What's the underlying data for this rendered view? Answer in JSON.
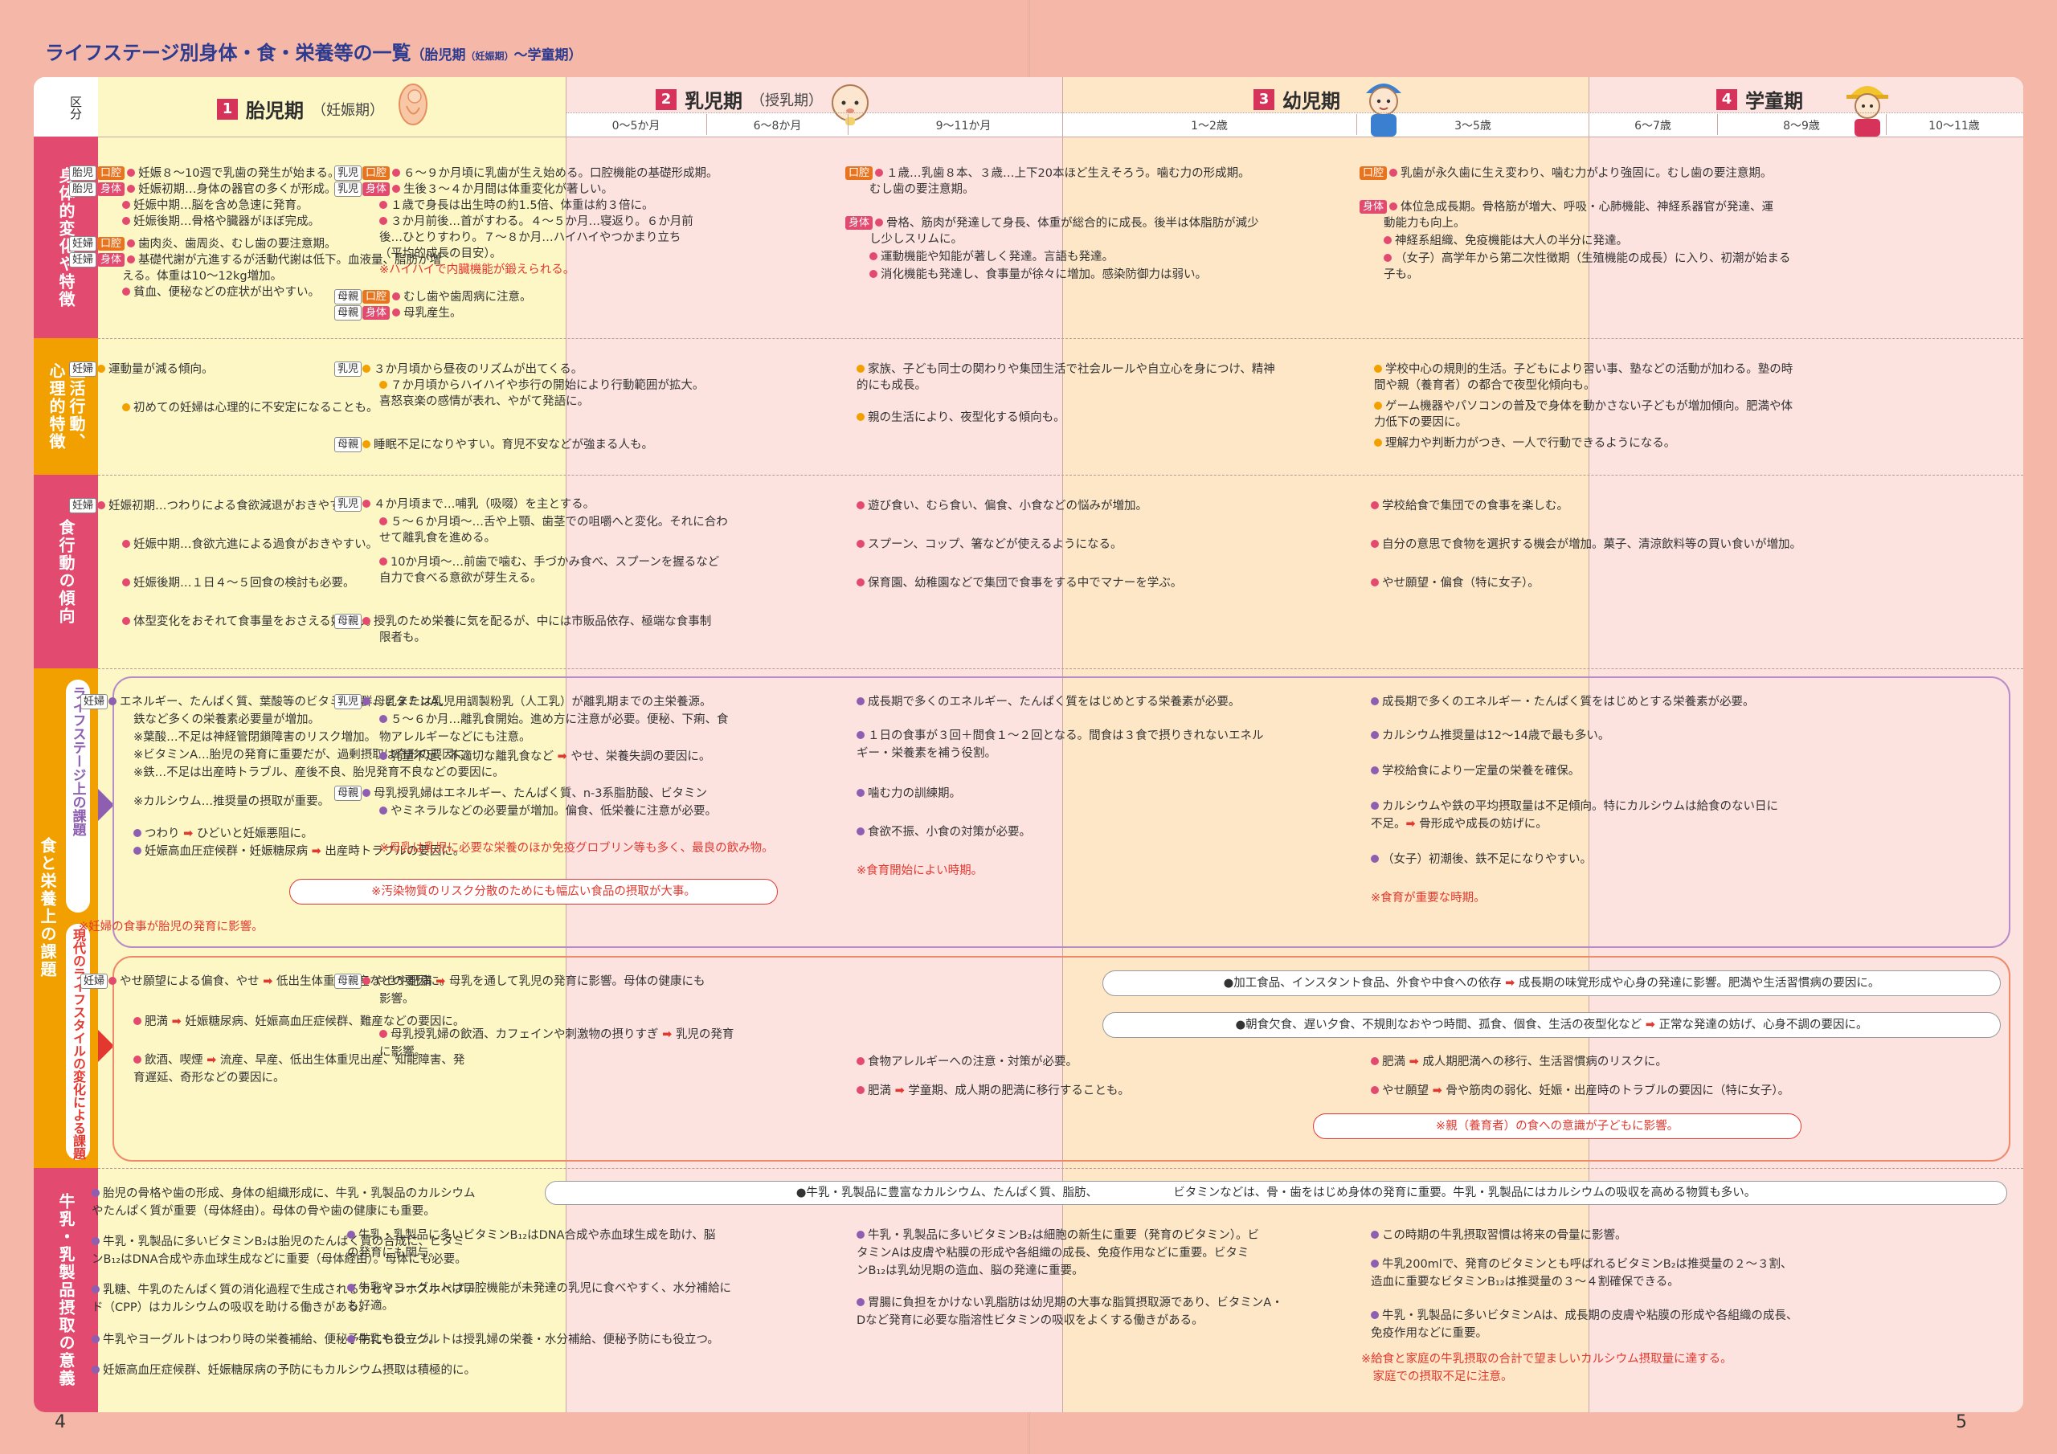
{
  "title": {
    "main": "ライフステージ別身体・食・栄養等の一覧",
    "paren_open": "（胎児期",
    "paren_small": "（妊娠期）",
    "paren_close": "～学童期）"
  },
  "page_numbers": {
    "left": "4",
    "right": "5"
  },
  "header": {
    "kubun": "区分",
    "stages": [
      {
        "num": "1",
        "label": "胎児期",
        "sub": "（妊娠期）",
        "ages": []
      },
      {
        "num": "2",
        "label": "乳児期",
        "sub": "（授乳期）",
        "ages": [
          "0～5か月",
          "6～8か月",
          "9～11か月"
        ]
      },
      {
        "num": "3",
        "label": "幼児期",
        "sub": "",
        "ages": [
          "1～2歳",
          "3～5歳"
        ]
      },
      {
        "num": "4",
        "label": "学童期",
        "sub": "",
        "ages": [
          "6～7歳",
          "8～9歳",
          "10～11歳"
        ]
      }
    ]
  },
  "row_labels": {
    "r1": "身体的変化や特徴",
    "r2a": "生活行動、",
    "r2b": "心理的特徴",
    "r3": "食行動の傾向",
    "r4": "食と栄養上の課題",
    "r4a": "ライフステージ上の課題",
    "r4b": "現代のライフスタイルの変化による課題",
    "r5": "牛乳・乳製品摂取の意義"
  },
  "colors": {
    "red_text": "#e3382f",
    "orange_dot": "#f2a000",
    "pink_dot": "#e24a6f",
    "purple_dot": "#8e5fb0",
    "title": "#2c3a8f"
  },
  "r1": {
    "c1": [
      {
        "tags": [
          "胎児",
          "口腔"
        ],
        "text": "妊娠８～10週で乳歯の発生が始まる。"
      },
      {
        "tags": [
          "胎児",
          "身体"
        ],
        "text": "妊娠初期…身体の器官の多くが形成。"
      },
      {
        "tags": [],
        "text": "妊娠中期…脳を含め急速に発育。"
      },
      {
        "tags": [],
        "text": "妊娠後期…骨格や臓器がほぼ完成。"
      },
      {
        "tags": [
          "妊婦",
          "口腔"
        ],
        "text": "歯肉炎、歯周炎、むし歯の要注意期。"
      },
      {
        "tags": [
          "妊婦",
          "身体"
        ],
        "text": "基礎代謝が亢進するが活動代謝は低下。血液量、脂肪が増"
      },
      {
        "tags": [],
        "text": "える。体重は10～12kg増加。"
      },
      {
        "tags": [],
        "text": "貧血、便秘などの症状が出やすい。"
      }
    ],
    "c2": [
      {
        "tags": [
          "乳児",
          "口腔"
        ],
        "text": "６～９か月頃に乳歯が生え始める。口腔機能の基礎形成期。"
      },
      {
        "tags": [
          "乳児",
          "身体"
        ],
        "text": "生後３～４か月間は体重変化が著しい。"
      },
      {
        "tags": [],
        "text": "１歳で身長は出生時の約1.5倍、体重は約３倍に。"
      },
      {
        "tags": [],
        "text": "３か月前後…首がすわる。４～５か月…寝返り。６か月前"
      },
      {
        "tags": [],
        "text": "後…ひとりすわり。７～８か月…ハイハイやつかまり立ち"
      },
      {
        "tags": [],
        "text": "（平均的成長の目安）。"
      },
      {
        "tags": [],
        "text": "※ハイハイで内臓機能が鍛えられる。"
      },
      {
        "tags": [
          "母親",
          "口腔"
        ],
        "text": "むし歯や歯周病に注意。"
      },
      {
        "tags": [
          "母親",
          "身体"
        ],
        "text": "母乳産生。"
      }
    ],
    "c3": [
      {
        "tags": [
          "口腔"
        ],
        "text": "１歳…乳歯８本、３歳…上下20本ほど生えそろう。噛む力の形成期。"
      },
      {
        "tags": [],
        "text": "むし歯の要注意期。"
      },
      {
        "tags": [
          "身体"
        ],
        "text": "骨格、筋肉が発達して身長、体重が総合的に成長。後半は体脂肪が減少"
      },
      {
        "tags": [],
        "text": "し少しスリムに。"
      },
      {
        "tags": [],
        "text": "運動機能や知能が著しく発達。言語も発達。"
      },
      {
        "tags": [],
        "text": "消化機能も発達し、食事量が徐々に増加。感染防御力は弱い。"
      }
    ],
    "c4": [
      {
        "tags": [
          "口腔"
        ],
        "text": "乳歯が永久歯に生え変わり、噛む力がより強固に。むし歯の要注意期。"
      },
      {
        "tags": [
          "身体"
        ],
        "text": "体位急成長期。骨格筋が増大、呼吸・心肺機能、神経系器官が発達、運"
      },
      {
        "tags": [],
        "text": "動能力も向上。"
      },
      {
        "tags": [],
        "text": "神経系組織、免疫機能は大人の半分に発達。"
      },
      {
        "tags": [],
        "text": "（女子）高学年から第二次性徴期（生殖機能の成長）に入り、初潮が始まる"
      },
      {
        "tags": [],
        "text": "子も。"
      }
    ]
  },
  "r2": {
    "c1": [
      {
        "tag": "妊婦",
        "text": "運動量が減る傾向。"
      },
      {
        "tag": "",
        "text": "初めての妊婦は心理的に不安定になることも。"
      }
    ],
    "c2": [
      {
        "tag": "乳児",
        "text": "３か月頃から昼夜のリズムが出てくる。"
      },
      {
        "tag": "",
        "text": "７か月頃からハイハイや歩行の開始により行動範囲が拡大。"
      },
      {
        "tag": "",
        "text": "喜怒哀楽の感情が表れ、やがて発語に。"
      },
      {
        "tag": "母親",
        "text": "睡眠不足になりやすい。育児不安などが強まる人も。"
      }
    ],
    "c3": [
      {
        "text": "家族、子ども同士の関わりや集団生活で社会ルールや自立心を身につけ、精神"
      },
      {
        "text": "的にも成長。"
      },
      {
        "text": "親の生活により、夜型化する傾向も。"
      }
    ],
    "c4": [
      {
        "text": "学校中心の規則的生活。子どもにより習い事、塾などの活動が加わる。塾の時"
      },
      {
        "text": "間や親（養育者）の都合で夜型化傾向も。"
      },
      {
        "text": "ゲーム機器やパソコンの普及で身体を動かさない子どもが増加傾向。肥満や体"
      },
      {
        "text": "力低下の要因に。"
      },
      {
        "text": "理解力や判断力がつき、一人で行動できるようになる。"
      }
    ]
  },
  "r3": {
    "c1": [
      {
        "tag": "妊婦",
        "text": "妊娠初期…つわりによる食欲減退がおきやすい。"
      },
      {
        "tag": "",
        "text": "妊娠中期…食欲亢進による過食がおきやすい。"
      },
      {
        "tag": "",
        "text": "妊娠後期…１日４～５回食の検討も必要。"
      },
      {
        "tag": "",
        "text": "体型変化をおそれて食事量をおさえる妊婦も。"
      }
    ],
    "c2": [
      {
        "tag": "乳児",
        "text": "４か月頃まで…哺乳（吸啜）を主とする。",
        "ruby": "きゅうてつ"
      },
      {
        "tag": "",
        "text": "５～６か月頃～…舌や上顎、歯茎での咀嚼へと変化。それに合わ"
      },
      {
        "tag": "",
        "text": "せて離乳食を進める。"
      },
      {
        "tag": "",
        "text": "10か月頃～…前歯で噛む、手づかみ食べ、スプーンを握るなど"
      },
      {
        "tag": "",
        "text": "自力で食べる意欲が芽生える。"
      },
      {
        "tag": "母親",
        "text": "授乳のため栄養に気を配るが、中には市販品依存、極端な食事制"
      },
      {
        "tag": "",
        "text": "限者も。"
      }
    ],
    "c3": [
      {
        "text": "遊び食い、むら食い、偏食、小食などの悩みが増加。"
      },
      {
        "text": "スプーン、コップ、箸などが使えるようになる。"
      },
      {
        "text": "保育園、幼稚園などで集団で食事をする中でマナーを学ぶ。"
      }
    ],
    "c4": [
      {
        "text": "学校給食で集団での食事を楽しむ。"
      },
      {
        "text": "自分の意思で食物を選択する機会が増加。菓子、清涼飲料等の買い食いが増加。"
      },
      {
        "text": "やせ願望・偏食（特に女子）。"
      }
    ]
  },
  "r4a": {
    "c1": [
      {
        "tag": "妊婦",
        "text": "エネルギー、たんぱく質、葉酸等のビタミンB群、ビタミンA、"
      },
      {
        "tag": "",
        "text": "鉄など多くの栄養素必要量が増加。"
      },
      {
        "tag": "",
        "text": "※葉酸…不足は神経管閉鎖障害のリスク増加。"
      },
      {
        "tag": "",
        "text": "※ビタミンA…胎児の発育に重要だが、過剰摂取は奇形の要因に。"
      },
      {
        "tag": "",
        "text": "※鉄…不足は出産時トラブル、産後不良、胎児発育不良などの要因に。"
      },
      {
        "tag": "",
        "text": "※カルシウム…推奨量の摂取が重要。"
      },
      {
        "tag": "",
        "text": "つわり ➡ ひどいと妊娠悪阻に。",
        "ruby": "おそ"
      },
      {
        "tag": "",
        "text": "妊娠高血圧症候群・妊娠糖尿病 ➡ 出産時トラブルの要因に。"
      }
    ],
    "pill": "※汚染物質のリスク分散のためにも幅広い食品の摂取が大事。",
    "c1_note": "※妊婦の食事が胎児の発育に影響。",
    "c2": [
      {
        "tag": "乳児",
        "text": "母乳または乳児用調製粉乳（人工乳）が離乳期までの主栄養源。"
      },
      {
        "tag": "",
        "text": "５～６か月…離乳食開始。進め方に注意が必要。便秘、下痢、食"
      },
      {
        "tag": "",
        "text": "物アレルギーなどにも注意。"
      },
      {
        "tag": "",
        "text": "乳量不足、不適切な離乳食など ➡ やせ、栄養失調の要因に。"
      },
      {
        "tag": "母親",
        "text": "母乳授乳婦はエネルギー、たんぱく質、n-3系脂肪酸、ビタミン"
      },
      {
        "tag": "",
        "text": "やミネラルなどの必要量が増加。偏食、低栄養に注意が必要。"
      },
      {
        "tag": "",
        "text": "※母乳は乳児に必要な栄養のほか免疫グロブリン等も多く、最良の飲み物。"
      }
    ],
    "c3": [
      {
        "text": "成長期で多くのエネルギー、たんぱく質をはじめとする栄養素が必要。"
      },
      {
        "text": "１日の食事が３回＋間食１～２回となる。間食は３食で摂りきれないエネル"
      },
      {
        "text": "ギー・栄養素を補う役割。"
      },
      {
        "text": "噛む力の訓練期。"
      },
      {
        "text": "食欲不振、小食の対策が必要。"
      },
      {
        "text": "※食育開始によい時期。"
      }
    ],
    "c4": [
      {
        "text": "成長期で多くのエネルギー・たんぱく質をはじめとする栄養素が必要。"
      },
      {
        "text": "カルシウム推奨量は12～14歳で最も多い。"
      },
      {
        "text": "学校給食により一定量の栄養を確保。"
      },
      {
        "text": "カルシウムや鉄の平均摂取量は不足傾向。特にカルシウムは給食のない日に"
      },
      {
        "text": "不足。➡ 骨形成や成長の妨げに。"
      },
      {
        "text": "（女子）初潮後、鉄不足になりやすい。"
      },
      {
        "text": "※食育が重要な時期。"
      }
    ]
  },
  "r4b": {
    "c1": [
      {
        "tag": "妊婦",
        "text": "やせ願望による偏食、やせ ➡ 低出生体重児出産などの要因に。"
      },
      {
        "tag": "",
        "text": "肥満 ➡ 妊娠糖尿病、妊娠高血圧症候群、難産などの要因に。"
      },
      {
        "tag": "",
        "text": "飲酒、喫煙 ➡ 流産、早産、低出生体重児出産、知能障害、発"
      },
      {
        "tag": "",
        "text": "育遅延、奇形などの要因に。"
      }
    ],
    "c2": [
      {
        "tag": "母親",
        "text": "やせや肥満 ➡ 母乳を通して乳児の発育に影響。母体の健康にも"
      },
      {
        "tag": "",
        "text": "影響。"
      },
      {
        "tag": "",
        "text": "母乳授乳婦の飲酒、カフェインや刺激物の摂りすぎ ➡ 乳児の発育"
      },
      {
        "tag": "",
        "text": "に影響。"
      }
    ],
    "pill1": "●加工食品、インスタント食品、外食や中食への依存 ➡ 成長期の味覚形成や心身の発達に影響。肥満や生活習慣病の要因に。",
    "pill2": "●朝食欠食、遅い夕食、不規則なおやつ時間、孤食、個食、生活の夜型化など ➡ 正常な発達の妨げ、心身不調の要因に。",
    "c3": [
      {
        "text": "食物アレルギーへの注意・対策が必要。"
      },
      {
        "text": "肥満 ➡ 学童期、成人期の肥満に移行することも。"
      }
    ],
    "c4": [
      {
        "text": "肥満 ➡ 成人期肥満への移行、生活習慣病のリスクに。"
      },
      {
        "text": "やせ願望 ➡ 骨や筋肉の弱化、妊娠・出産時のトラブルの要因に（特に女子）。"
      }
    ],
    "pill3": "※親（養育者）の食への意識が子どもに影響。"
  },
  "r5": {
    "c1": [
      {
        "text": "胎児の骨格や歯の形成、身体の組織形成に、牛乳・乳製品のカルシウム"
      },
      {
        "text": "やたんぱく質が重要（母体経由）。母体の骨や歯の健康にも重要。"
      },
      {
        "text": "牛乳・乳製品に多いビタミンB₂は胎児のたんぱく質の合成に、ビタミ"
      },
      {
        "text": "ンB₁₂はDNA合成や赤血球生成などに重要（母体経由）。母体にも必要。"
      },
      {
        "text": "乳糖、牛乳のたんぱく質の消化過程で生成されるカゼインホスホペプチ"
      },
      {
        "text": "ド（CPP）はカルシウムの吸収を助ける働きがある。"
      },
      {
        "text": "牛乳やヨーグルトはつわり時の栄養補給、便秘予防にも役立つ。"
      },
      {
        "text": "妊娠高血圧症候群、妊娠糖尿病の予防にもカルシウム摂取は積極的に。"
      }
    ],
    "pill": "●牛乳・乳製品に豊富なカルシウム、たんぱく質、脂肪、　　　　　　　ビタミンなどは、骨・歯をはじめ身体の発育に重要。牛乳・乳製品にはカルシウムの吸収を高める物質も多い。",
    "c2": [
      {
        "text": "牛乳・乳製品に多いビタミンB₁₂はDNA合成や赤血球生成を助け、脳"
      },
      {
        "text": "の発育にも関与。"
      },
      {
        "text": "牛乳やヨーグルトは口腔機能が未発達の乳児に食べやすく、水分補給に"
      },
      {
        "text": "も好適。"
      },
      {
        "text": "牛乳やヨーグルトは授乳婦の栄養・水分補給、便秘予防にも役立つ。"
      }
    ],
    "c3": [
      {
        "text": "牛乳・乳製品に多いビタミンB₂は細胞の新生に重要（発育のビタミン）。ビ"
      },
      {
        "text": "タミンAは皮膚や粘膜の形成や各組織の成長、免疫作用などに重要。ビタミ"
      },
      {
        "text": "ンB₁₂は乳幼児期の造血、脳の発達に重要。"
      },
      {
        "text": "胃腸に負担をかけない乳脂肪は幼児期の大事な脂質摂取源であり、ビタミンA・"
      },
      {
        "text": "Dなど発育に必要な脂溶性ビタミンの吸収をよくする働きがある。"
      }
    ],
    "c4": [
      {
        "text": "この時期の牛乳摂取習慣は将来の骨量に影響。"
      },
      {
        "text": "牛乳200mlで、発育のビタミンとも呼ばれるビタミンB₂は推奨量の２～３割、"
      },
      {
        "text": "造血に重要なビタミンB₁₂は推奨量の３～４割確保できる。"
      },
      {
        "text": "牛乳・乳製品に多いビタミンAは、成長期の皮膚や粘膜の形成や各組織の成長、"
      },
      {
        "text": "免疫作用などに重要。"
      },
      {
        "text": "※給食と家庭の牛乳摂取の合計で望ましいカルシウム摂取量に達する。"
      },
      {
        "text": "　家庭での摂取不足に注意。"
      }
    ]
  }
}
